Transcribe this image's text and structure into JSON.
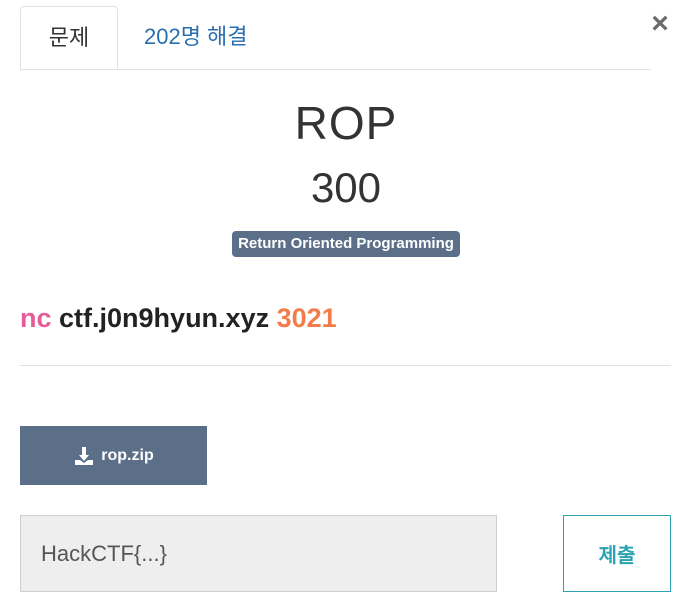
{
  "tabs": {
    "problem_label": "문제",
    "solves_label": "202명 해결"
  },
  "close_symbol": "×",
  "challenge": {
    "title": "ROP",
    "points": "300",
    "tag": "Return Oriented Programming"
  },
  "description": {
    "command": "nc",
    "host": "ctf.j0n9hyun.xyz",
    "port": "3021"
  },
  "download": {
    "label": "rop.zip",
    "icon": "download-icon"
  },
  "flag_form": {
    "placeholder": "HackCTF{...}",
    "value": "",
    "submit_label": "제출"
  },
  "colors": {
    "tag_bg": "#5c6f88",
    "command": "#e75b9a",
    "port": "#f47c4a",
    "submit": "#2aa3b5",
    "tab_link": "#2a6fb0"
  }
}
